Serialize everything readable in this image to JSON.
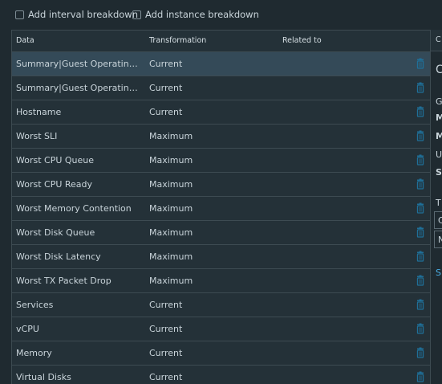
{
  "options": {
    "interval_label": "Add interval breakdown",
    "instance_label": "Add instance breakdown"
  },
  "columns": {
    "data": "Data",
    "transformation": "Transformation",
    "related_to": "Related to"
  },
  "rows": [
    {
      "data": "Summary|Guest Operating System|Full Name",
      "transformation": "Current",
      "selected": true
    },
    {
      "data": "Summary|Guest Operating System|Full Name",
      "transformation": "Current"
    },
    {
      "data": "Hostname",
      "transformation": "Current"
    },
    {
      "data": "Worst SLI",
      "transformation": "Maximum"
    },
    {
      "data": "Worst CPU Queue",
      "transformation": "Maximum"
    },
    {
      "data": "Worst CPU Ready",
      "transformation": "Maximum"
    },
    {
      "data": "Worst Memory Contention",
      "transformation": "Maximum"
    },
    {
      "data": "Worst Disk Queue",
      "transformation": "Maximum"
    },
    {
      "data": "Worst Disk Latency",
      "transformation": "Maximum"
    },
    {
      "data": "Worst TX Packet Drop",
      "transformation": "Maximum"
    },
    {
      "data": "Services",
      "transformation": "Current"
    },
    {
      "data": "vCPU",
      "transformation": "Current"
    },
    {
      "data": "Memory",
      "transformation": "Current"
    },
    {
      "data": "Virtual Disks",
      "transformation": "Current"
    }
  ],
  "right_panel": {
    "header": "C",
    "title": "C",
    "g": "G",
    "m1": "M",
    "m2": "M",
    "u": "U",
    "s": "S",
    "t": "T",
    "box1": "C",
    "box2": "N",
    "link": "S"
  },
  "colors": {
    "background": "#1f2a30",
    "grid": "#243138",
    "selected_row": "#344a58",
    "trash_icon": "#1f6f98",
    "link": "#49aee5"
  }
}
